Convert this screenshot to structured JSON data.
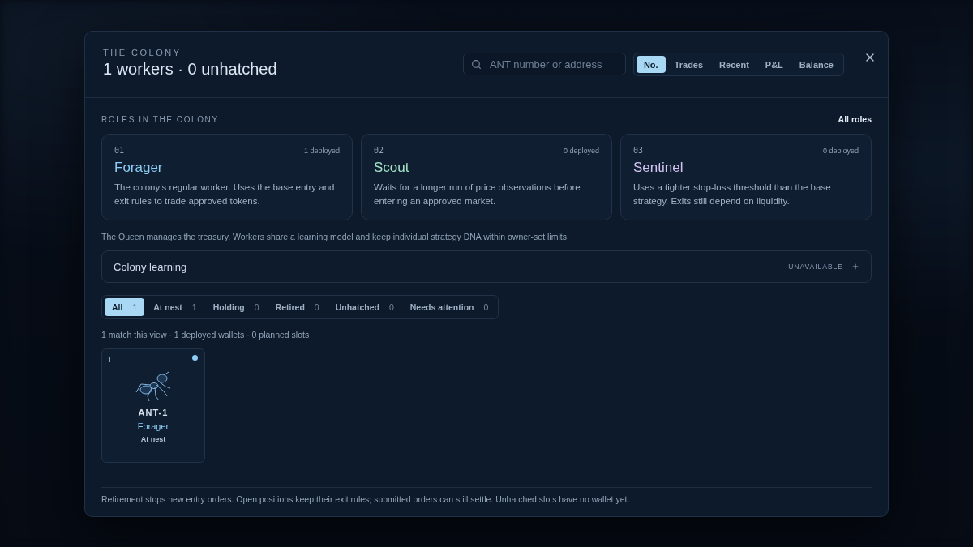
{
  "modal": {
    "eyebrow": "THE COLONY",
    "title": "1 workers · 0 unhatched",
    "search": {
      "placeholder": "ANT number or address"
    },
    "sort_tabs": [
      {
        "label": "No.",
        "selected": true
      },
      {
        "label": "Trades",
        "selected": false
      },
      {
        "label": "Recent",
        "selected": false
      },
      {
        "label": "P&L",
        "selected": false
      },
      {
        "label": "Balance",
        "selected": false
      }
    ]
  },
  "roles": {
    "heading": "ROLES IN THE COLONY",
    "link": "All roles",
    "items": [
      {
        "number": "01",
        "deployed": "1 deployed",
        "name": "Forager",
        "color": "#8ecdf5",
        "description": "The colony’s regular worker. Uses the base entry and exit rules to trade approved tokens."
      },
      {
        "number": "02",
        "deployed": "0 deployed",
        "name": "Scout",
        "color": "#a6e3c8",
        "description": "Waits for a longer run of price observations before entering an approved market."
      },
      {
        "number": "03",
        "deployed": "0 deployed",
        "name": "Sentinel",
        "color": "#d4c4f2",
        "description": "Uses a tighter stop-loss threshold than the base strategy. Exits still depend on liquidity."
      }
    ],
    "note": "The Queen manages the treasury. Workers share a learning model and keep individual strategy DNA within owner-set limits."
  },
  "learning": {
    "label": "Colony learning",
    "status": "UNAVAILABLE",
    "expanded": false
  },
  "filters": [
    {
      "label": "All",
      "count": "1",
      "selected": true
    },
    {
      "label": "At nest",
      "count": "1",
      "selected": false
    },
    {
      "label": "Holding",
      "count": "0",
      "selected": false
    },
    {
      "label": "Retired",
      "count": "0",
      "selected": false
    },
    {
      "label": "Unhatched",
      "count": "0",
      "selected": false
    },
    {
      "label": "Needs attention",
      "count": "0",
      "selected": false
    }
  ],
  "summary": "1 match this view · 1 deployed wallets · 0 planned slots",
  "workers": [
    {
      "name": "ANT-1",
      "role": "Forager",
      "status": "At nest",
      "color": "#8ecdf5"
    }
  ],
  "footer": "Retirement stops new entry orders. Open positions keep their exit rules; submitted orders can still settle. Unhatched slots have no wallet yet."
}
